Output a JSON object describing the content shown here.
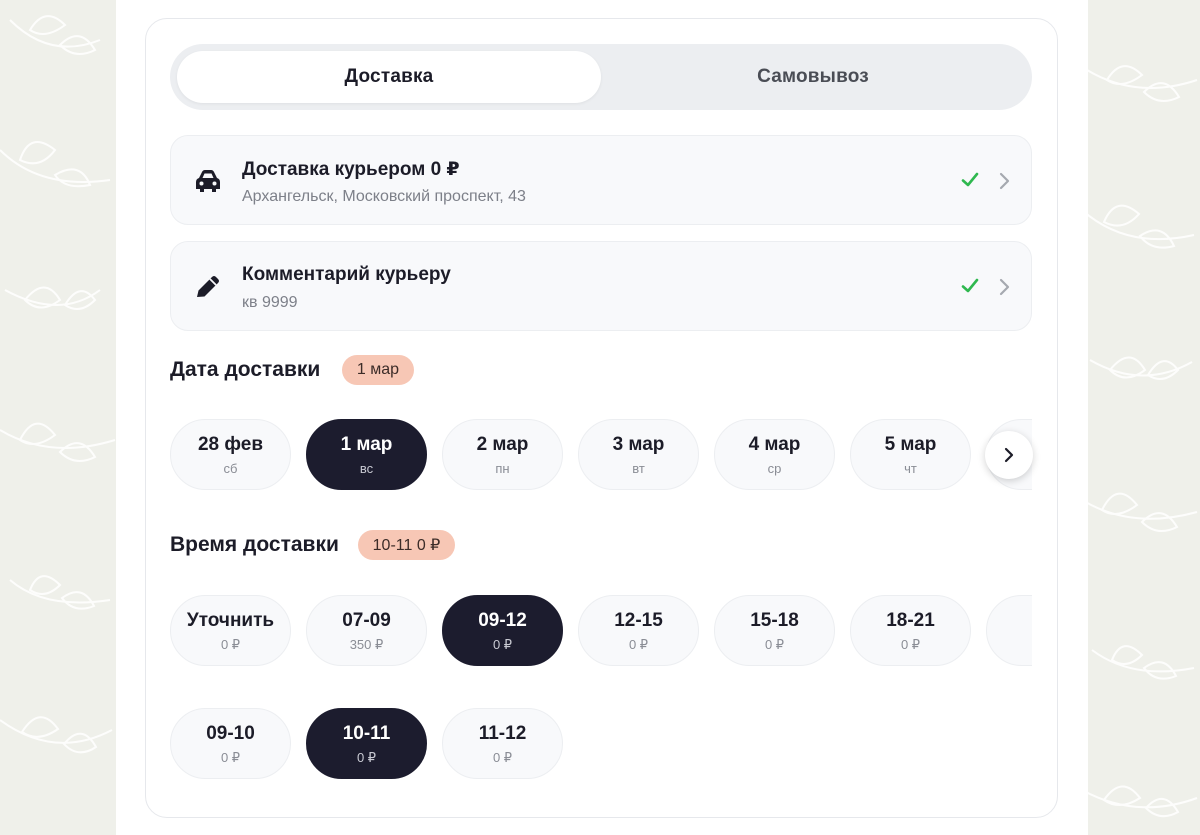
{
  "tabs": [
    {
      "label": "Доставка",
      "active": true
    },
    {
      "label": "Самовывоз",
      "active": false
    }
  ],
  "delivery_option": {
    "icon": "car-icon",
    "title": "Доставка курьером 0 ₽",
    "address": "Архангельск, Московский проспект, 43"
  },
  "comment_option": {
    "icon": "pencil-icon",
    "title": "Комментарий курьеру",
    "value": "кв 9999"
  },
  "date_section": {
    "title": "Дата доставки",
    "selected_badge": "1 мар",
    "dates": [
      {
        "label": "28 фев",
        "weekday": "сб"
      },
      {
        "label": "1 мар",
        "weekday": "вс",
        "selected": true
      },
      {
        "label": "2 мар",
        "weekday": "пн"
      },
      {
        "label": "3 мар",
        "weekday": "вт"
      },
      {
        "label": "4 мар",
        "weekday": "ср"
      },
      {
        "label": "5 мар",
        "weekday": "чт"
      }
    ]
  },
  "time_section": {
    "title": "Время доставки",
    "selected_badge": "10-11 0 ₽",
    "slots_row1": [
      {
        "label": "Уточнить",
        "price": "0 ₽"
      },
      {
        "label": "07-09",
        "price": "350 ₽"
      },
      {
        "label": "09-12",
        "price": "0 ₽",
        "selected": true
      },
      {
        "label": "12-15",
        "price": "0 ₽"
      },
      {
        "label": "15-18",
        "price": "0 ₽"
      },
      {
        "label": "18-21",
        "price": "0 ₽"
      }
    ],
    "slots_row2": [
      {
        "label": "09-10",
        "price": "0 ₽"
      },
      {
        "label": "10-11",
        "price": "0 ₽",
        "selected": true
      },
      {
        "label": "11-12",
        "price": "0 ₽"
      }
    ]
  },
  "colors": {
    "accent_dark": "#1c1c2e",
    "badge_bg": "#f7c7b5",
    "check_green": "#2fb84f"
  }
}
